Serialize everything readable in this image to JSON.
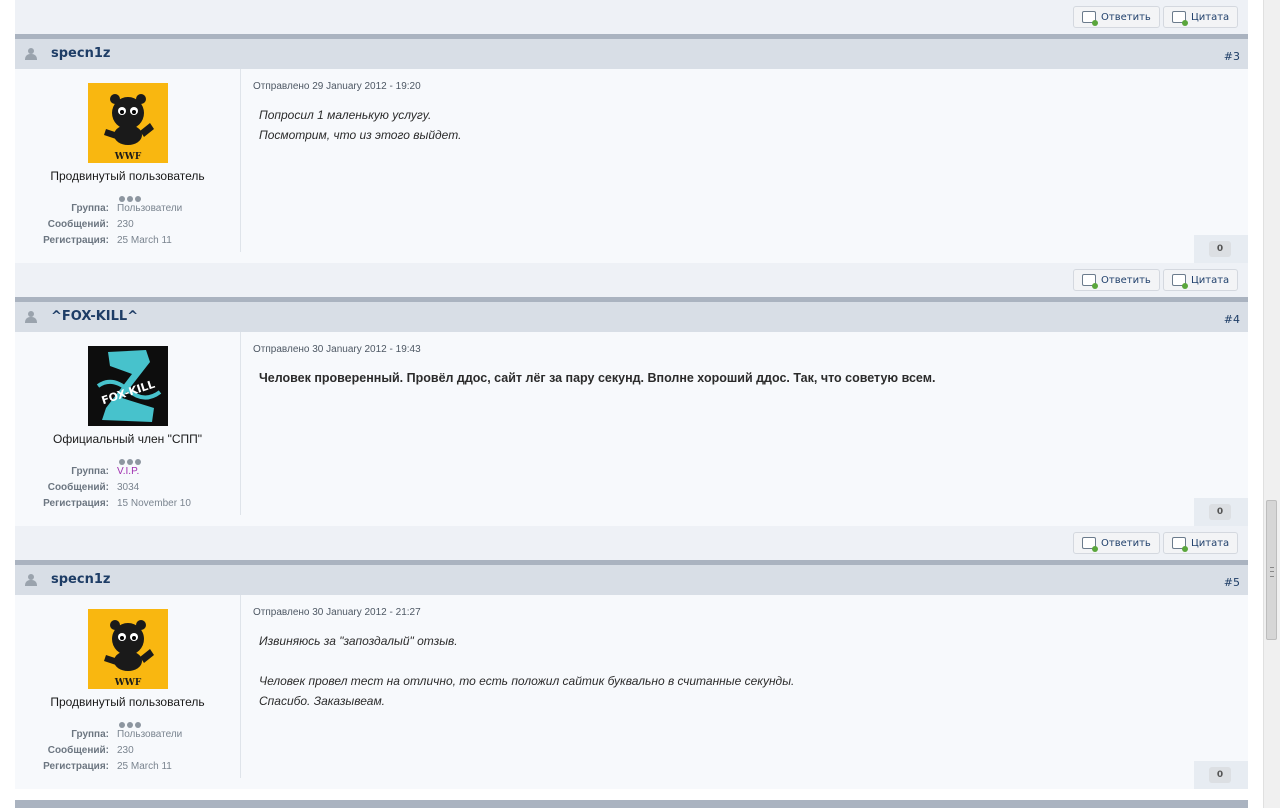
{
  "buttons": {
    "reply": "Ответить",
    "quote": "Цитата"
  },
  "labels": {
    "group": "Группа:",
    "posts": "Сообщений:",
    "registered": "Регистрация:"
  },
  "posts": [
    {
      "author": "specn1z",
      "num": "#3",
      "posted": "Отправлено 29 January 2012 - 19:20",
      "title": "Продвинутый пользователь",
      "group": "Пользователи",
      "post_count": "230",
      "registered": "25 March 11",
      "rep": "0",
      "lines": [
        "Попросил 1 маленькую услугу.",
        "Посмотрим, что из этого выйдет."
      ],
      "avatar": "panda-wwf",
      "avatar_text": "WWF"
    },
    {
      "author": "^FOX-KILL^",
      "num": "#4",
      "posted": "Отправлено 30 January 2012 - 19:43",
      "title": "Официальный член \"СПП\"",
      "group": "V.I.P.",
      "post_count": "3034",
      "registered": "15 November 10",
      "rep": "0",
      "lines": [
        "Человек проверенный. Провёл ддос, сайт лёг за пару секунд. Вполне хороший ддос. Так, что советую всем."
      ],
      "avatar": "fox-kill",
      "avatar_text": "FOX-KILL"
    },
    {
      "author": "specn1z",
      "num": "#5",
      "posted": "Отправлено 30 January 2012 - 21:27",
      "title": "Продвинутый пользователь",
      "group": "Пользователи",
      "post_count": "230",
      "registered": "25 March 11",
      "rep": "0",
      "lines": [
        "Извиняюсь за \"запоздалый\" отзыв.",
        "",
        "Человек провел тест на отлично, то есть положил сайтик буквально в считанные секунды.",
        "Спасибо. Заказывеам."
      ],
      "avatar": "panda-wwf",
      "avatar_text": "WWF"
    }
  ],
  "colors": {
    "header": "#d8dee6",
    "body": "#f7f9fc",
    "link": "#1e3d66",
    "vip": "#a030b0"
  }
}
